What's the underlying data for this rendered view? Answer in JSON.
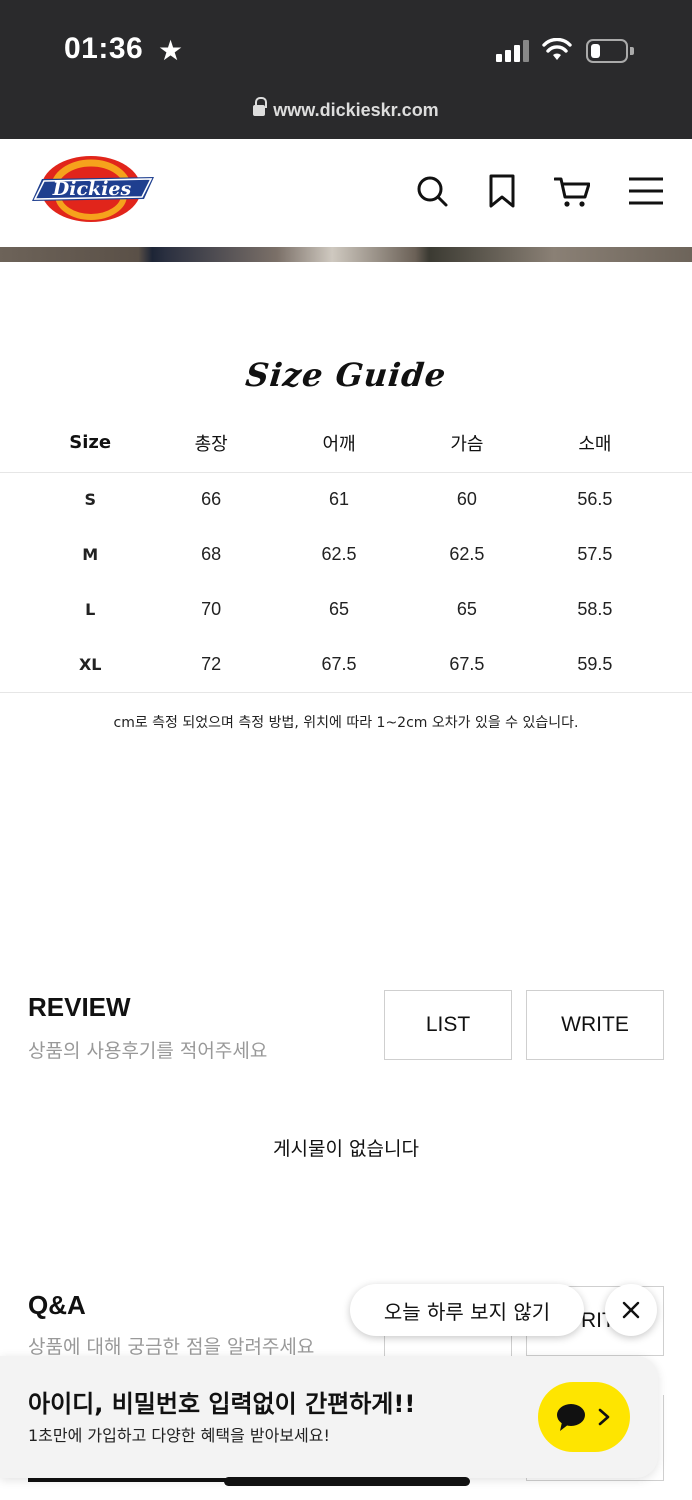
{
  "status_bar": {
    "time": "01:36",
    "url": "www.dickieskr.com"
  },
  "header": {
    "logo_text": "Dickies"
  },
  "size_guide": {
    "title": "Size Guide",
    "columns": [
      "Size",
      "총장",
      "어깨",
      "가슴",
      "소매"
    ],
    "rows": [
      [
        "S",
        "66",
        "61",
        "60",
        "56.5"
      ],
      [
        "M",
        "68",
        "62.5",
        "62.5",
        "57.5"
      ],
      [
        "L",
        "70",
        "65",
        "65",
        "58.5"
      ],
      [
        "XL",
        "72",
        "67.5",
        "67.5",
        "59.5"
      ]
    ],
    "note": "cm로 측정 되었으며 측정 방법, 위치에 따라 1~2cm 오차가 있을 수 있습니다."
  },
  "review": {
    "title": "REVIEW",
    "subtitle": "상품의 사용후기를 적어주세요",
    "list_label": "LIST",
    "write_label": "WRITE",
    "empty_text": "게시물이 없습니다"
  },
  "qna": {
    "title": "Q&A",
    "subtitle": "상품에 대해 궁금한 점을 알려주세요",
    "write_partial": "RIT"
  },
  "popup": {
    "today_label": "오늘 하루 보지 않기",
    "close_symbol": "✕"
  },
  "signup_banner": {
    "title": "아이디, 비밀번호 입력없이 간편하게!!",
    "subtitle": "1초만에 가입하고 다양한 혜택을 받아보세요!",
    "kakao_color": "#FEE500"
  }
}
